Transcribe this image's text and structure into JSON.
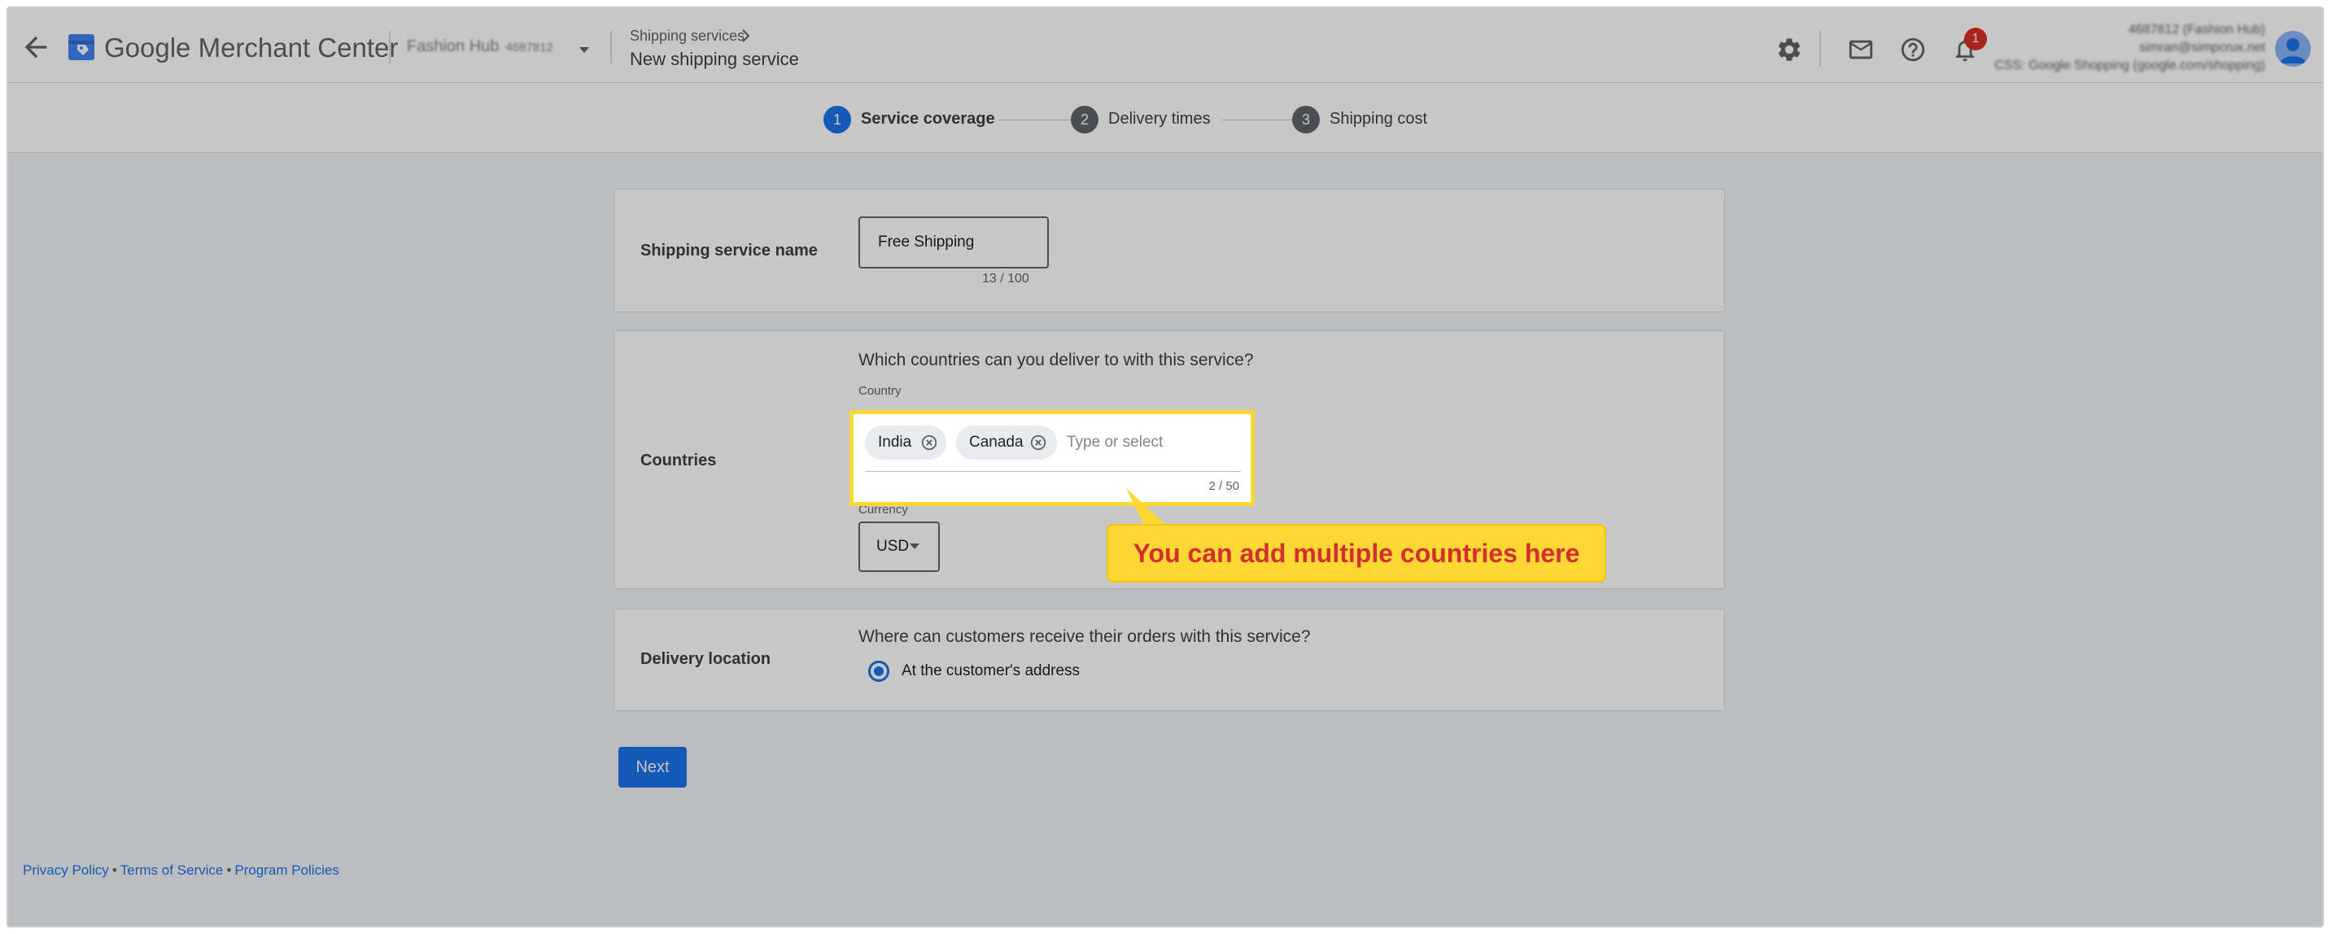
{
  "header": {
    "brand": "Google Merchant Center",
    "account_name": "Fashion Hub",
    "account_id": "4687812",
    "breadcrumb_parent": "Shipping services",
    "page_title": "New shipping service",
    "notification_count": "1",
    "user_account_line": "4687812 (Fashion Hub)",
    "user_email": "simran@simpcrux.net",
    "user_css_line": "CSS: Google Shopping (google.com/shopping)"
  },
  "stepper": {
    "steps": [
      {
        "num": "1",
        "label": "Service coverage",
        "active": true
      },
      {
        "num": "2",
        "label": "Delivery times",
        "active": false
      },
      {
        "num": "3",
        "label": "Shipping cost",
        "active": false
      }
    ]
  },
  "name_card": {
    "label": "Shipping service name",
    "value": "Free Shipping",
    "count": "13 / 100"
  },
  "countries_card": {
    "label": "Countries",
    "question": "Which countries can you deliver to with this service?",
    "country_label": "Country",
    "chips": [
      "India",
      "Canada"
    ],
    "placeholder": "Type or select",
    "count": "2 / 50",
    "currency_label": "Currency",
    "currency_value": "USD"
  },
  "delivery_card": {
    "label": "Delivery location",
    "question": "Where can customers receive their orders with this service?",
    "option": "At the customer's address"
  },
  "next_label": "Next",
  "footer": {
    "privacy": "Privacy Policy",
    "terms": "Terms of Service",
    "program": "Program Policies",
    "separator": "•"
  },
  "callout": {
    "text": "You can add multiple countries here"
  },
  "colors": {
    "accent": "#1a73e8",
    "highlight": "#fdd835",
    "callout_text": "#d32f2f",
    "badge": "#d93025"
  }
}
